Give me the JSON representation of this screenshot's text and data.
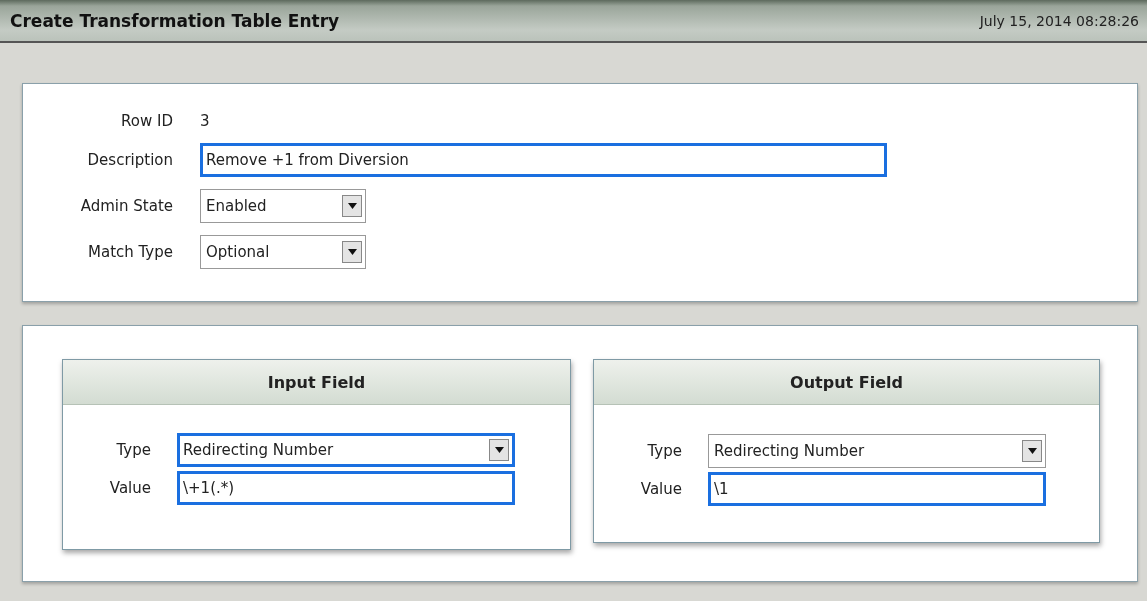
{
  "header": {
    "title": "Create Transformation Table Entry",
    "timestamp": "July 15, 2014 08:28:26"
  },
  "entry": {
    "fields": [
      {
        "kind": "text",
        "label": "Row ID",
        "value": "3"
      },
      {
        "kind": "input",
        "label": "Description",
        "value": "Remove +1 from Diversion",
        "highlighted": true
      },
      {
        "kind": "select",
        "label": "Admin State",
        "value": "Enabled",
        "highlighted": false
      },
      {
        "kind": "select",
        "label": "Match Type",
        "value": "Optional",
        "highlighted": false
      }
    ]
  },
  "groups": [
    {
      "title": "Input Field",
      "fields": [
        {
          "kind": "select",
          "label": "Type",
          "value": "Redirecting Number",
          "highlighted": true
        },
        {
          "kind": "input",
          "label": "Value",
          "value": "\\+1(.*)",
          "highlighted": true
        }
      ]
    },
    {
      "title": "Output Field",
      "fields": [
        {
          "kind": "select",
          "label": "Type",
          "value": "Redirecting Number",
          "highlighted": false
        },
        {
          "kind": "input",
          "label": "Value",
          "value": "\\1",
          "highlighted": true
        }
      ]
    }
  ]
}
